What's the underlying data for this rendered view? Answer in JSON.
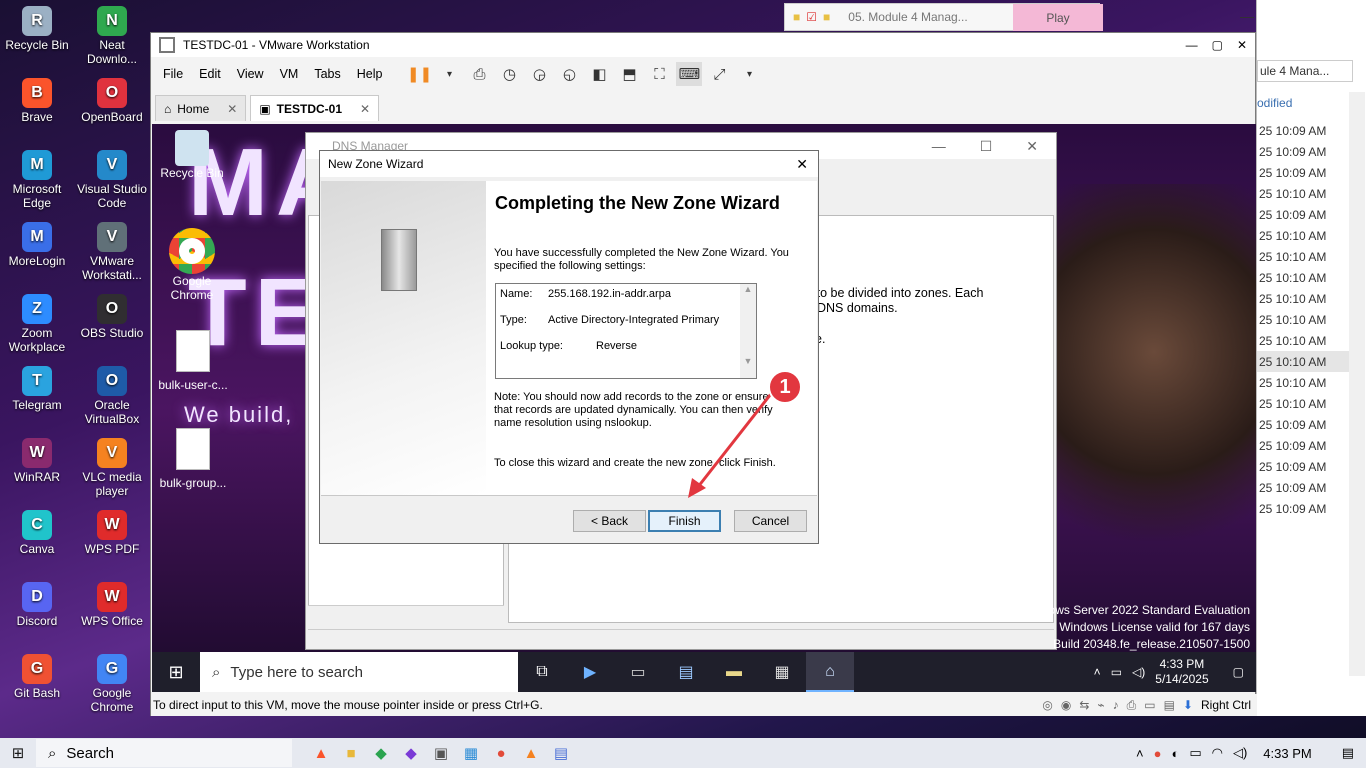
{
  "desktop": {
    "icons": [
      {
        "label": "Recycle Bin",
        "color": "#9bb0c4"
      },
      {
        "label": "Neat Downlo...",
        "color": "#2fa84f"
      },
      {
        "label": "Brave",
        "color": "#fb542b"
      },
      {
        "label": "OpenBoard",
        "color": "#e0323e"
      },
      {
        "label": "Microsoft Edge",
        "color": "#1f9ad6"
      },
      {
        "label": "Visual Studio Code",
        "color": "#2489ca"
      },
      {
        "label": "MoreLogin",
        "color": "#3a6ee8"
      },
      {
        "label": "VMware Workstati...",
        "color": "#607078"
      },
      {
        "label": "Zoom Workplace",
        "color": "#2d8cff"
      },
      {
        "label": "OBS Studio",
        "color": "#302e31"
      },
      {
        "label": "Telegram",
        "color": "#2aa3df"
      },
      {
        "label": "Oracle VirtualBox",
        "color": "#1e5ba8"
      },
      {
        "label": "WinRAR",
        "color": "#8a2a6e"
      },
      {
        "label": "VLC media player",
        "color": "#f58220"
      },
      {
        "label": "Canva",
        "color": "#20c4cb"
      },
      {
        "label": "WPS PDF",
        "color": "#e02b2b"
      },
      {
        "label": "Discord",
        "color": "#5865f2"
      },
      {
        "label": "WPS Office",
        "color": "#e02b2b"
      },
      {
        "label": "Git Bash",
        "color": "#f05133"
      },
      {
        "label": "Google Chrome",
        "color": "#4285f4"
      }
    ]
  },
  "browser_tab": {
    "title": "05. Module 4 Manag...",
    "play": "Play"
  },
  "vmware": {
    "title": "TESTDC-01 - VMware Workstation",
    "menu": [
      "File",
      "Edit",
      "View",
      "VM",
      "Tabs",
      "Help"
    ],
    "tabs": [
      {
        "label": "Home"
      },
      {
        "label": "TESTDC-01"
      }
    ],
    "status": "To direct input to this VM, move the mouse pointer inside or press Ctrl+G.",
    "right_ctrl": "Right Ctrl"
  },
  "guest": {
    "desktop_icons": [
      "Recycle Bin",
      "Google Chrome",
      "bulk-user-c...",
      "bulk-group..."
    ],
    "bg_text": {
      "line1": "MA",
      "line2": "TE",
      "line3": "We build, "
    },
    "watermark": [
      "Windows Server 2022 Standard Evaluation",
      "Windows License valid for 167 days",
      "Build 20348.fe_release.210507-1500"
    ],
    "taskbar": {
      "search": "Type here to search",
      "time": "4:33 PM",
      "date": "5/14/2025"
    }
  },
  "dns": {
    "title": "DNS Manager",
    "bg_text_1": "ace to be divided into zones. Each",
    "bg_text_2": "DNS domains.",
    "bg_text_3": "e."
  },
  "wizard": {
    "title": "New Zone Wizard",
    "heading": "Completing the New Zone Wizard",
    "intro": "You have successfully completed the New Zone Wizard. You specified the following settings:",
    "settings": [
      {
        "key": "Name:",
        "value": "255.168.192.in-addr.arpa"
      },
      {
        "key": "Type:",
        "value": "Active Directory-Integrated Primary"
      },
      {
        "key": "Lookup type:",
        "value": "Reverse"
      }
    ],
    "note": "Note: You should now add records to the zone or ensure that records are updated dynamically. You can then verify name resolution using nslookup.",
    "close_text": "To close this wizard and create the new zone, click Finish.",
    "back": "< Back",
    "finish": "Finish",
    "cancel": "Cancel",
    "annotation": "1"
  },
  "explorer_pane": {
    "search": "ule 4 Mana...",
    "header": "odified",
    "times": [
      "25 10:09 AM",
      "25 10:09 AM",
      "25 10:09 AM",
      "25 10:10 AM",
      "25 10:09 AM",
      "25 10:10 AM",
      "25 10:10 AM",
      "25 10:10 AM",
      "25 10:10 AM",
      "25 10:10 AM",
      "25 10:10 AM",
      "25 10:10 AM",
      "25 10:10 AM",
      "25 10:10 AM",
      "25 10:09 AM",
      "25 10:09 AM",
      "25 10:09 AM",
      "25 10:09 AM",
      "25 10:09 AM"
    ],
    "selected_index": 11
  },
  "host_taskbar": {
    "search": "Search",
    "time": "4:33 PM"
  },
  "colors": {
    "accent": "#3c7fb1",
    "annotation": "#e2373f"
  }
}
